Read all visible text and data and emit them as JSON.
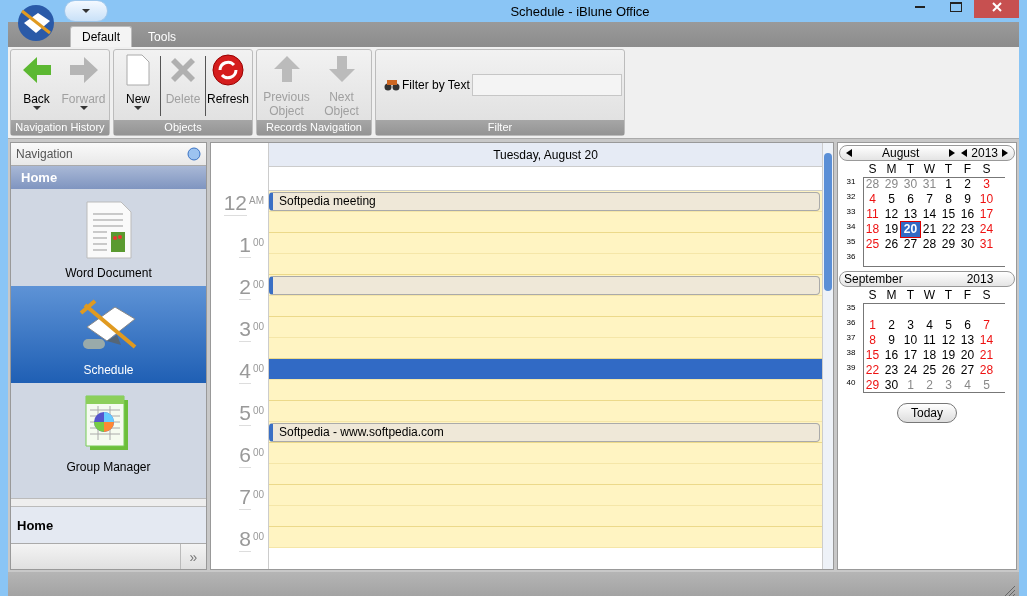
{
  "window": {
    "title": "Schedule - iBlune Office"
  },
  "tabs": [
    {
      "label": "Default",
      "selected": true
    },
    {
      "label": "Tools",
      "selected": false
    }
  ],
  "ribbon": [
    {
      "label": "Navigation History",
      "buttons": [
        {
          "kind": "back",
          "label": "Back",
          "disabled": false,
          "dropdown": true
        },
        {
          "kind": "forward",
          "label": "Forward",
          "disabled": true,
          "dropdown": true
        }
      ]
    },
    {
      "label": "Objects",
      "buttons": [
        {
          "kind": "new",
          "label": "New",
          "disabled": false,
          "dropdown": true
        },
        {
          "kind": "delete",
          "label": "Delete",
          "disabled": true,
          "dropdown": false
        },
        {
          "kind": "refresh",
          "label": "Refresh",
          "disabled": false,
          "dropdown": false
        }
      ]
    },
    {
      "label": "Records Navigation",
      "buttons": [
        {
          "kind": "previous",
          "label": "Previous Object",
          "disabled": true,
          "dropdown": false
        },
        {
          "kind": "next",
          "label": "Next Object",
          "disabled": true,
          "dropdown": false
        }
      ]
    },
    {
      "label": "Filter",
      "filter_label": "Filter by Text"
    }
  ],
  "navigation": {
    "header": "Navigation",
    "section": "Home",
    "items": [
      {
        "kind": "document",
        "label": "Word Document",
        "selected": false
      },
      {
        "kind": "schedule",
        "label": "Schedule",
        "selected": true
      },
      {
        "kind": "groups",
        "label": "Group Manager",
        "selected": false
      }
    ],
    "footer": "Home",
    "footer_button": "»"
  },
  "schedule": {
    "date": "Tuesday, August 20",
    "hours": [
      {
        "hour": "12",
        "minutes": "AM"
      },
      {
        "hour": "1",
        "minutes": "00"
      },
      {
        "hour": "2",
        "minutes": "00"
      },
      {
        "hour": "3",
        "minutes": "00"
      },
      {
        "hour": "4",
        "minutes": "00"
      },
      {
        "hour": "5",
        "minutes": "00"
      },
      {
        "hour": "6",
        "minutes": "00"
      },
      {
        "hour": "7",
        "minutes": "00"
      },
      {
        "hour": "8",
        "minutes": "00"
      }
    ],
    "slots": [
      {
        "kind": "event",
        "text": "Softpedia meeting"
      },
      {
        "kind": "empty"
      },
      {
        "kind": "empty"
      },
      {
        "kind": "empty"
      },
      {
        "kind": "event"
      },
      {
        "kind": "empty"
      },
      {
        "kind": "empty"
      },
      {
        "kind": "empty"
      },
      {
        "kind": "selected"
      },
      {
        "kind": "empty"
      },
      {
        "kind": "empty"
      },
      {
        "kind": "event",
        "text": "Softpedia - www.softpedia.com"
      },
      {
        "kind": "empty"
      },
      {
        "kind": "empty"
      },
      {
        "kind": "empty"
      },
      {
        "kind": "empty"
      },
      {
        "kind": "empty"
      }
    ]
  },
  "calendar": {
    "months": [
      {
        "month": "August",
        "year": "2013",
        "navigable": true,
        "weekdays": [
          "S",
          "M",
          "T",
          "W",
          "T",
          "F",
          "S"
        ],
        "weeks": [
          {
            "number": "31",
            "days": [
              {
                "day": "28",
                "kind": "other",
                "selected": false
              },
              {
                "day": "29",
                "kind": "other",
                "selected": false
              },
              {
                "day": "30",
                "kind": "other",
                "selected": false
              },
              {
                "day": "31",
                "kind": "other",
                "selected": false
              },
              {
                "day": "1",
                "kind": "weekday",
                "selected": false
              },
              {
                "day": "2",
                "kind": "weekday",
                "selected": false
              },
              {
                "day": "3",
                "kind": "weekend",
                "selected": false
              }
            ]
          },
          {
            "number": "32",
            "days": [
              {
                "day": "4",
                "kind": "weekend",
                "selected": false
              },
              {
                "day": "5",
                "kind": "weekday",
                "selected": false
              },
              {
                "day": "6",
                "kind": "weekday",
                "selected": false
              },
              {
                "day": "7",
                "kind": "weekday",
                "selected": false
              },
              {
                "day": "8",
                "kind": "weekday",
                "selected": false
              },
              {
                "day": "9",
                "kind": "weekday",
                "selected": false
              },
              {
                "day": "10",
                "kind": "weekend",
                "selected": false
              }
            ]
          },
          {
            "number": "33",
            "days": [
              {
                "day": "11",
                "kind": "weekend",
                "selected": false
              },
              {
                "day": "12",
                "kind": "weekday",
                "selected": false
              },
              {
                "day": "13",
                "kind": "weekday",
                "selected": false
              },
              {
                "day": "14",
                "kind": "weekday",
                "selected": false
              },
              {
                "day": "15",
                "kind": "weekday",
                "selected": false
              },
              {
                "day": "16",
                "kind": "weekday",
                "selected": false
              },
              {
                "day": "17",
                "kind": "weekend",
                "selected": false
              }
            ]
          },
          {
            "number": "34",
            "days": [
              {
                "day": "18",
                "kind": "weekend",
                "selected": false
              },
              {
                "day": "19",
                "kind": "weekday",
                "selected": false
              },
              {
                "day": "20",
                "kind": "weekday",
                "selected": true
              },
              {
                "day": "21",
                "kind": "weekday",
                "selected": false
              },
              {
                "day": "22",
                "kind": "weekday",
                "selected": false
              },
              {
                "day": "23",
                "kind": "weekday",
                "selected": false
              },
              {
                "day": "24",
                "kind": "weekend",
                "selected": false
              }
            ]
          },
          {
            "number": "35",
            "days": [
              {
                "day": "25",
                "kind": "weekend",
                "selected": false
              },
              {
                "day": "26",
                "kind": "weekday",
                "selected": false
              },
              {
                "day": "27",
                "kind": "weekday",
                "selected": false
              },
              {
                "day": "28",
                "kind": "weekday",
                "selected": false
              },
              {
                "day": "29",
                "kind": "weekday",
                "selected": false
              },
              {
                "day": "30",
                "kind": "weekday",
                "selected": false
              },
              {
                "day": "31",
                "kind": "weekend",
                "selected": false
              }
            ]
          },
          {
            "number": "36"
          }
        ]
      },
      {
        "month": "September",
        "year": "2013",
        "navigable": false,
        "weekdays": [
          "S",
          "M",
          "T",
          "W",
          "T",
          "F",
          "S"
        ],
        "weeks": [
          {
            "number": "35"
          },
          {
            "number": "36",
            "days": [
              {
                "day": "1",
                "kind": "weekend",
                "selected": false
              },
              {
                "day": "2",
                "kind": "weekday",
                "selected": false
              },
              {
                "day": "3",
                "kind": "weekday",
                "selected": false
              },
              {
                "day": "4",
                "kind": "weekday",
                "selected": false
              },
              {
                "day": "5",
                "kind": "weekday",
                "selected": false
              },
              {
                "day": "6",
                "kind": "weekday",
                "selected": false
              },
              {
                "day": "7",
                "kind": "weekend",
                "selected": false
              }
            ]
          },
          {
            "number": "37",
            "days": [
              {
                "day": "8",
                "kind": "weekend",
                "selected": false
              },
              {
                "day": "9",
                "kind": "weekday",
                "selected": false
              },
              {
                "day": "10",
                "kind": "weekday",
                "selected": false
              },
              {
                "day": "11",
                "kind": "weekday",
                "selected": false
              },
              {
                "day": "12",
                "kind": "weekday",
                "selected": false
              },
              {
                "day": "13",
                "kind": "weekday",
                "selected": false
              },
              {
                "day": "14",
                "kind": "weekend",
                "selected": false
              }
            ]
          },
          {
            "number": "38",
            "days": [
              {
                "day": "15",
                "kind": "weekend",
                "selected": false
              },
              {
                "day": "16",
                "kind": "weekday",
                "selected": false
              },
              {
                "day": "17",
                "kind": "weekday",
                "selected": false
              },
              {
                "day": "18",
                "kind": "weekday",
                "selected": false
              },
              {
                "day": "19",
                "kind": "weekday",
                "selected": false
              },
              {
                "day": "20",
                "kind": "weekday",
                "selected": false
              },
              {
                "day": "21",
                "kind": "weekend",
                "selected": false
              }
            ]
          },
          {
            "number": "39",
            "days": [
              {
                "day": "22",
                "kind": "weekend",
                "selected": false
              },
              {
                "day": "23",
                "kind": "weekday",
                "selected": false
              },
              {
                "day": "24",
                "kind": "weekday",
                "selected": false
              },
              {
                "day": "25",
                "kind": "weekday",
                "selected": false
              },
              {
                "day": "26",
                "kind": "weekday",
                "selected": false
              },
              {
                "day": "27",
                "kind": "weekday",
                "selected": false
              },
              {
                "day": "28",
                "kind": "weekend",
                "selected": false
              }
            ]
          },
          {
            "number": "40",
            "days": [
              {
                "day": "29",
                "kind": "weekend",
                "selected": false
              },
              {
                "day": "30",
                "kind": "weekday",
                "selected": false
              },
              {
                "day": "1",
                "kind": "other",
                "selected": false
              },
              {
                "day": "2",
                "kind": "other",
                "selected": false
              },
              {
                "day": "3",
                "kind": "other",
                "selected": false
              },
              {
                "day": "4",
                "kind": "other",
                "selected": false
              },
              {
                "day": "5",
                "kind": "other",
                "selected": false
              }
            ]
          }
        ]
      }
    ],
    "today_button": "Today"
  }
}
